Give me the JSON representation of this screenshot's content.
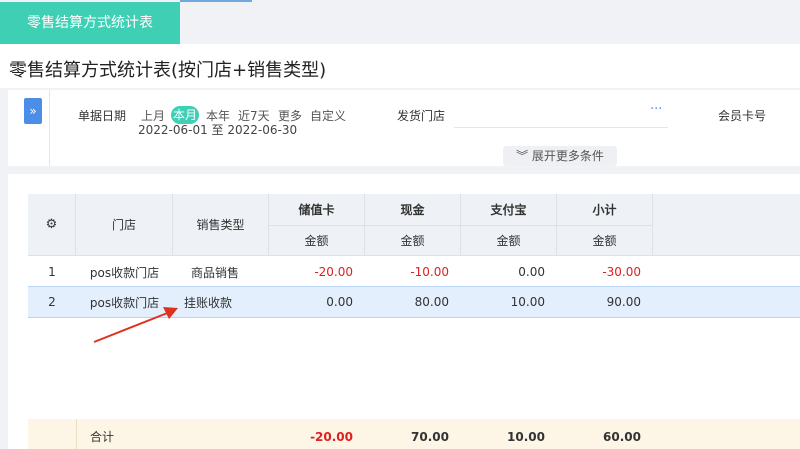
{
  "tab": {
    "label": "零售结算方式统计表"
  },
  "page": {
    "title": "零售结算方式统计表(按门店+销售类型)"
  },
  "filters": {
    "expand_icon": "double-chevron-right-icon",
    "date_label": "单据日期",
    "date_options": [
      "上月",
      "本月",
      "本年",
      "近7天",
      "更多",
      "自定义"
    ],
    "date_selected": "本月",
    "date_range": "2022-06-01 至 2022-06-30",
    "store_label": "发货门店",
    "store_picker": "···",
    "member_label": "会员卡号",
    "more_conditions": "展开更多条件"
  },
  "table": {
    "settings_icon": "gear-icon",
    "col_store": "门店",
    "col_type": "销售类型",
    "groups": [
      "储值卡",
      "现金",
      "支付宝",
      "小计"
    ],
    "sub_label": "金额",
    "rows": [
      {
        "idx": "1",
        "store": "pos收款门店",
        "type": "商品销售",
        "card": "-20.00",
        "cash": "-10.00",
        "alipay": "0.00",
        "subtotal": "-30.00"
      },
      {
        "idx": "2",
        "store": "pos收款门店",
        "type": "挂账收款",
        "card": "0.00",
        "cash": "80.00",
        "alipay": "10.00",
        "subtotal": "90.00"
      }
    ],
    "total": {
      "label": "合计",
      "card": "-20.00",
      "cash": "70.00",
      "alipay": "10.00",
      "subtotal": "60.00"
    }
  },
  "colors": {
    "accent": "#3ecfb4",
    "primary": "#4b8ee8",
    "negative": "#e02020",
    "arrow": "#e0301e"
  }
}
